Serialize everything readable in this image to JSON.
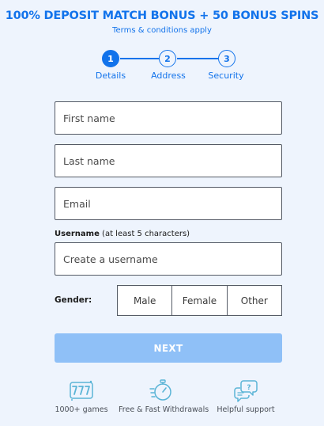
{
  "colors": {
    "accent": "#1273eb",
    "button": "#8fc0f7",
    "background": "#eef4fd",
    "icon": "#5ab4d6"
  },
  "promo": {
    "title": "100% DEPOSIT MATCH BONUS + 50 BONUS SPINS",
    "subtitle": "Terms & conditions apply"
  },
  "stepper": [
    {
      "number": "1",
      "label": "Details",
      "active": true
    },
    {
      "number": "2",
      "label": "Address",
      "active": false
    },
    {
      "number": "3",
      "label": "Security",
      "active": false
    }
  ],
  "form": {
    "first_name": {
      "placeholder": "First name",
      "value": ""
    },
    "last_name": {
      "placeholder": "Last name",
      "value": ""
    },
    "email": {
      "placeholder": "Email",
      "value": ""
    },
    "username": {
      "label": "Username",
      "hint": "(at least 5 characters)",
      "placeholder": "Create a username",
      "value": ""
    },
    "gender": {
      "label": "Gender:",
      "options": [
        "Male",
        "Female",
        "Other"
      ]
    },
    "next_label": "NEXT"
  },
  "features": [
    {
      "icon": "slot-777-icon",
      "label": "1000+ games"
    },
    {
      "icon": "stopwatch-icon",
      "label": "Free & Fast Withdrawals"
    },
    {
      "icon": "chat-support-icon",
      "label": "Helpful support"
    }
  ]
}
